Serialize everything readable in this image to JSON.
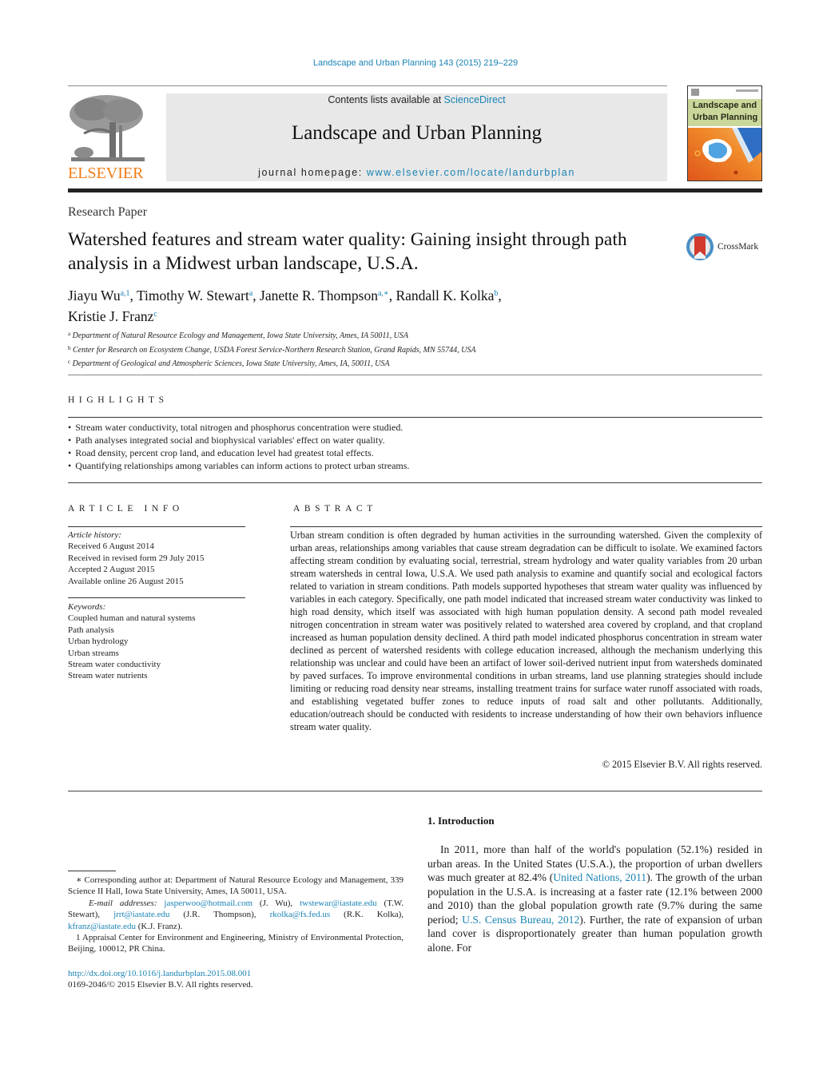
{
  "header": {
    "journal_ref": "Landscape and Urban Planning 143 (2015) 219–229",
    "contents_prefix": "Contents lists available at ",
    "contents_link": "ScienceDirect",
    "journal_title": "Landscape and Urban Planning",
    "homepage_prefix": "journal homepage: ",
    "homepage_link": "www.elsevier.com/locate/landurbplan",
    "publisher_logo_text": "ELSEVIER",
    "cover_title_line1": "Landscape and",
    "cover_title_line2": "Urban Planning"
  },
  "article": {
    "type": "Research Paper",
    "title": "Watershed features and stream water quality: Gaining insight through path analysis in a Midwest urban landscape, U.S.A.",
    "crossmark_label": "CrossMark",
    "authors": [
      {
        "name": "Jiayu Wu",
        "sup": "a,1",
        "sep": ", "
      },
      {
        "name": "Timothy W. Stewart",
        "sup": "a",
        "sep": ", "
      },
      {
        "name": "Janette R. Thompson",
        "sup": "a,∗",
        "sep": ", "
      },
      {
        "name": "Randall K. Kolka",
        "sup": "b",
        "sep": ","
      },
      {
        "name": "Kristie J. Franz",
        "sup": "c",
        "sep": ""
      }
    ],
    "affiliations": [
      {
        "key": "a",
        "text": "Department of Natural Resource Ecology and Management, Iowa State University, Ames, IA 50011, USA"
      },
      {
        "key": "b",
        "text": "Center for Research on Ecosystem Change, USDA Forest Service-Northern Research Station, Grand Rapids, MN 55744, USA"
      },
      {
        "key": "c",
        "text": "Department of Geological and Atmospheric Sciences, Iowa State University, Ames, IA, 50011, USA"
      }
    ]
  },
  "highlights": {
    "heading": "HIGHLIGHTS",
    "items": [
      "Stream water conductivity, total nitrogen and phosphorus concentration were studied.",
      "Path analyses integrated social and biophysical variables' effect on water quality.",
      "Road density, percent crop land, and education level had greatest total effects.",
      "Quantifying relationships among variables can inform actions to protect urban streams."
    ]
  },
  "article_info": {
    "heading": "ARTICLE INFO",
    "history_label": "Article history:",
    "history": [
      "Received 6 August 2014",
      "Received in revised form 29 July 2015",
      "Accepted 2 August 2015",
      "Available online 26 August 2015"
    ],
    "keywords_label": "Keywords:",
    "keywords": [
      "Coupled human and natural systems",
      "Path analysis",
      "Urban hydrology",
      "Urban streams",
      "Stream water conductivity",
      "Stream water nutrients"
    ]
  },
  "abstract": {
    "heading": "ABSTRACT",
    "text": "Urban stream condition is often degraded by human activities in the surrounding watershed. Given the complexity of urban areas, relationships among variables that cause stream degradation can be difficult to isolate. We examined factors affecting stream condition by evaluating social, terrestrial, stream hydrology and water quality variables from 20 urban stream watersheds in central Iowa, U.S.A. We used path analysis to examine and quantify social and ecological factors related to variation in stream conditions. Path models supported hypotheses that stream water quality was influenced by variables in each category. Specifically, one path model indicated that increased stream water conductivity was linked to high road density, which itself was associated with high human population density. A second path model revealed nitrogen concentration in stream water was positively related to watershed area covered by cropland, and that cropland increased as human population density declined. A third path model indicated phosphorus concentration in stream water declined as percent of watershed residents with college education increased, although the mechanism underlying this relationship was unclear and could have been an artifact of lower soil-derived nutrient input from watersheds dominated by paved surfaces. To improve environmental conditions in urban streams, land use planning strategies should include limiting or reducing road density near streams, installing treatment trains for surface water runoff associated with roads, and establishing vegetated buffer zones to reduce inputs of road salt and other pollutants. Additionally, education/outreach should be conducted with residents to increase understanding of how their own behaviors influence stream water quality.",
    "copyright": "© 2015 Elsevier B.V. All rights reserved."
  },
  "introduction": {
    "heading": "1.  Introduction",
    "p1_a": "In 2011, more than half of the world's population (52.1%) resided in urban areas. In the United States (U.S.A.), the proportion of urban dwellers was much greater at 82.4% (",
    "cite1": "United Nations, 2011",
    "p1_b": "). The growth of the urban population in the U.S.A. is increasing at a faster rate (12.1% between 2000 and 2010) than the global population growth rate (9.7% during the same period; ",
    "cite2": "U.S. Census Bureau, 2012",
    "p1_c": "). Further, the rate of expansion of urban land cover is disproportionately greater than human population growth alone. For"
  },
  "footnotes": {
    "corresponding": "∗  Corresponding author at: Department of Natural Resource Ecology and Management, 339 Science II Hall, Iowa State University, Ames, IA 50011, USA.",
    "email_label": "E-mail addresses:",
    "emails": [
      {
        "addr": "jasperwoo@hotmail.com",
        "who": " (J. Wu), "
      },
      {
        "addr": "twstewar@iastate.edu",
        "who": " (T.W. Stewart), "
      },
      {
        "addr": "jrrt@iastate.edu",
        "who": " (J.R. Thompson), "
      },
      {
        "addr": "rkolka@fs.fed.us",
        "who": " (R.K. Kolka), "
      },
      {
        "addr": "kfranz@iastate.edu",
        "who": " (K.J. Franz)."
      }
    ],
    "note1": "1  Appraisal Center for Environment and Engineering, Ministry of Environmental Protection, Beijing, 100012, PR China.",
    "doi": "http://dx.doi.org/10.1016/j.landurbplan.2015.08.001",
    "issn_copyright": "0169-2046/© 2015 Elsevier B.V. All rights reserved."
  },
  "colors": {
    "link": "#1a83b5",
    "elsevier_orange": "#f07c13",
    "header_box": "#e8e8e8"
  }
}
